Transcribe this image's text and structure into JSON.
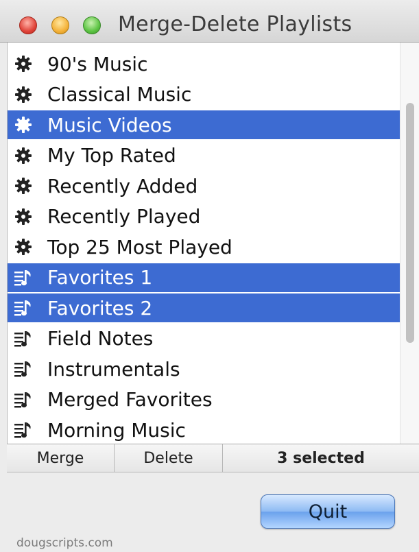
{
  "window": {
    "title": "Merge-Delete Playlists"
  },
  "playlists": [
    {
      "label": "90's Music",
      "icon": "gear-icon",
      "selected": false
    },
    {
      "label": "Classical Music",
      "icon": "gear-icon",
      "selected": false
    },
    {
      "label": "Music Videos",
      "icon": "gear-icon",
      "selected": true
    },
    {
      "label": "My Top Rated",
      "icon": "gear-icon",
      "selected": false
    },
    {
      "label": "Recently Added",
      "icon": "gear-icon",
      "selected": false
    },
    {
      "label": "Recently Played",
      "icon": "gear-icon",
      "selected": false
    },
    {
      "label": "Top 25 Most Played",
      "icon": "gear-icon",
      "selected": false
    },
    {
      "label": "Favorites 1",
      "icon": "playlist-icon",
      "selected": true
    },
    {
      "label": "Favorites 2",
      "icon": "playlist-icon",
      "selected": true
    },
    {
      "label": "Field Notes",
      "icon": "playlist-icon",
      "selected": false
    },
    {
      "label": "Instrumentals",
      "icon": "playlist-icon",
      "selected": false
    },
    {
      "label": "Merged Favorites",
      "icon": "playlist-icon",
      "selected": false
    },
    {
      "label": "Morning Music",
      "icon": "playlist-icon",
      "selected": false
    }
  ],
  "toolbar": {
    "merge_label": "Merge",
    "delete_label": "Delete",
    "selection_count": "3 selected"
  },
  "quit_label": "Quit",
  "footer_text": "dougscripts.com",
  "colors": {
    "selection": "#3d6bd2",
    "button_blue": "#8dbaf3"
  }
}
